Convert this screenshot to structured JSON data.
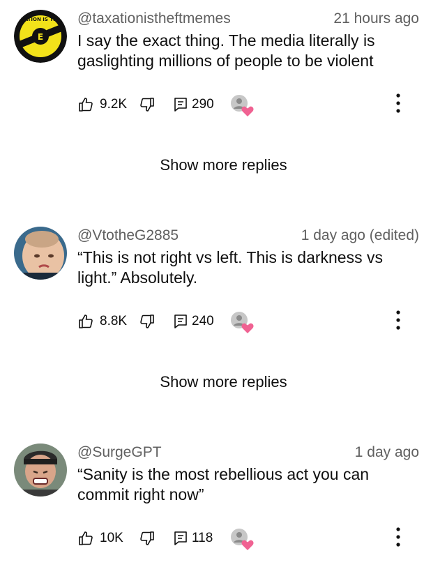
{
  "comments": [
    {
      "handle": "@taxationistheftmemes",
      "time": "21 hours ago",
      "text": "I say the exact thing. The media literally is gaslighting millions of people to be violent",
      "likes": "9.2K",
      "replies": "290",
      "avatar_icon": "taxation-logo-avatar",
      "avatar_text": "TAXATION IS THEFT"
    },
    {
      "handle": "@VtotheG2885",
      "time": "1 day ago (edited)",
      "text": "“This is not right vs left. This is darkness vs light.” Absolutely.",
      "likes": "8.8K",
      "replies": "240",
      "avatar_icon": "baby-photo-avatar"
    },
    {
      "handle": "@SurgeGPT",
      "time": "1 day ago",
      "text": "“Sanity is the most rebellious act you can commit right now”",
      "likes": "10K",
      "replies": "118",
      "avatar_icon": "man-photo-avatar"
    }
  ],
  "show_more": [
    "Show more replies",
    "Show more replies"
  ],
  "colors": {
    "secondary_text": "#606060",
    "heart": "#f06292",
    "icon": "#0f0f0f"
  }
}
